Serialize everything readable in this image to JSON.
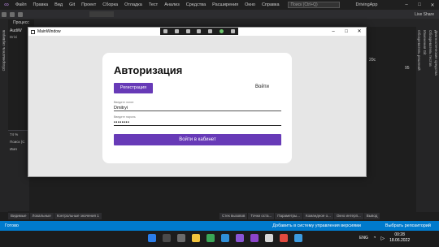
{
  "vs": {
    "menu": [
      "Файл",
      "Правка",
      "Вид",
      "Git",
      "Проект",
      "Сборка",
      "Отладка",
      "Тест",
      "Анализ",
      "Средства",
      "Расширения",
      "Окно",
      "Справка"
    ],
    "search_placeholder": "Поиск (Ctrl+Q)",
    "solution_name": "DrivingApp",
    "live_share": "Live Share",
    "tab_label": "Процесс",
    "left_rail_text": "Обозреватель серверов",
    "left_panel_title": "AudiW",
    "left_panel_sub": "Drivi",
    "right_zoom": "20c",
    "right_zoom_value": "95",
    "right_rail_texts": [
      "Обозреватель решений",
      "Изменения Git",
      "Обозреватель тестов",
      "Диагностические средства"
    ],
    "left_output": [
      "74 %",
      "Поиск (C",
      "Имя"
    ],
    "bottom_tabs_left": [
      "Видимые",
      "Локальные",
      "Контрольные значения 1"
    ],
    "bottom_tabs_right": [
      "Стек вызовов",
      "Точки оста...",
      "Параметры...",
      "Командное о...",
      "Окно интерп...",
      "Вывод"
    ],
    "status_left": "Готово",
    "status_mid": "Добавить в систему управления версиями",
    "status_right": "Выбрать репозиторий"
  },
  "taskbar": {
    "lang": "ENG",
    "time": "00:28",
    "date": "18.06.2022"
  },
  "window": {
    "title": "MainWindow",
    "auth": {
      "title": "Авторизация",
      "register_button": "Регистрация",
      "login_tab": "Войти",
      "login_label": "Введите логин",
      "login_value": "Dmitryi",
      "password_label": "Введите пароль",
      "password_value": "••••••••",
      "submit_button": "Войти в кабинет"
    }
  },
  "colors": {
    "accent": "#673ab7",
    "vs_status": "#007acc"
  }
}
